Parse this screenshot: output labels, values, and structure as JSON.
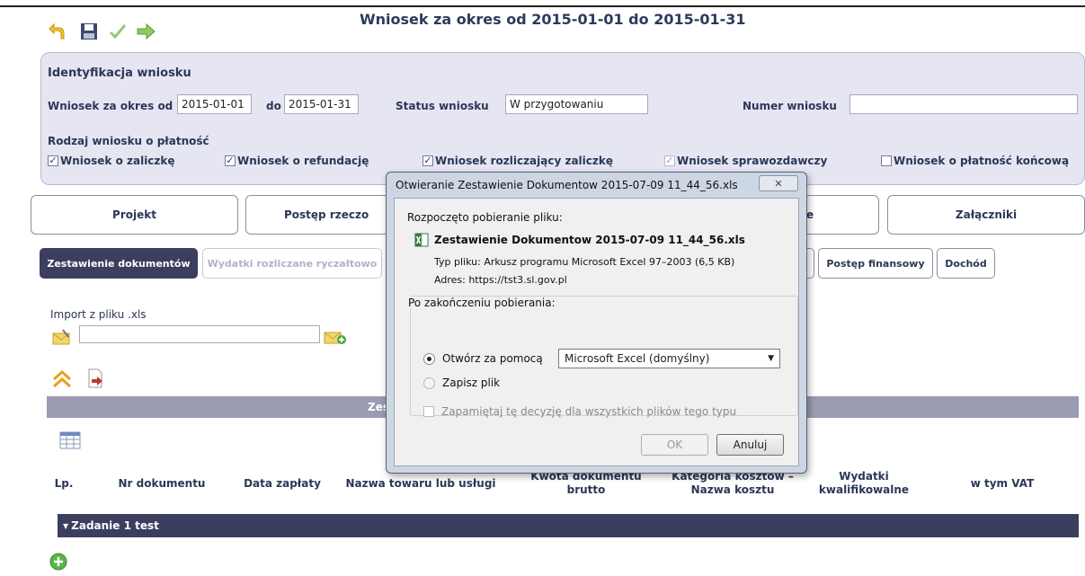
{
  "header": {
    "title": "Wniosek za okres od 2015-01-01 do 2015-01-31",
    "toolbar": [
      "undo-icon",
      "save-icon",
      "check-icon",
      "forward-icon"
    ]
  },
  "identification": {
    "section_title": "Identyfikacja wniosku",
    "period_label": "Wniosek za okres od",
    "period_from": "2015-01-01",
    "period_to_label": "do",
    "period_to": "2015-01-31",
    "status_label": "Status wniosku",
    "status_value": "W przygotowaniu",
    "number_label": "Numer wniosku",
    "number_value": "",
    "kind_label": "Rodzaj wniosku o płatność",
    "kinds": [
      {
        "label": "Wniosek o zaliczkę",
        "checked": true,
        "disabled": false
      },
      {
        "label": "Wniosek o refundację",
        "checked": true,
        "disabled": false
      },
      {
        "label": "Wniosek rozliczający zaliczkę",
        "checked": true,
        "disabled": false
      },
      {
        "label": "Wniosek sprawozdawczy",
        "checked": true,
        "disabled": true
      },
      {
        "label": "Wniosek o płatność końcową",
        "checked": false,
        "disabled": false
      }
    ]
  },
  "main_tabs": [
    "Projekt",
    "Postęp rzeczo",
    "e",
    "Załączniki"
  ],
  "sub_tabs": [
    "Zestawienie dokumentów",
    "Wydatki rozliczane ryczałtowo",
    "Postęp finansowy",
    "Dochód"
  ],
  "import": {
    "label": "Import z pliku .xls",
    "value": ""
  },
  "table": {
    "band_title": "Zes",
    "band_title_right": "",
    "columns": [
      "Lp.",
      "Nr dokumentu",
      "Data zapłaty",
      "Nazwa towaru lub usługi",
      "Kwota dokumentu brutto",
      "Kategoria kosztów – Nazwa kosztu",
      "Wydatki kwalifikowalne",
      "w tym VAT"
    ],
    "group_row": "Zadanie 1 test"
  },
  "dialog": {
    "title": "Otwieranie Zestawienie Dokumentow 2015-07-09 11_44_56.xls",
    "intro": "Rozpoczęto pobieranie pliku:",
    "file_name": "Zestawienie Dokumentow 2015-07-09 11_44_56.xls",
    "type_label": "Typ pliku:",
    "type_value": "Arkusz programu Microsoft Excel 97–2003 (6,5 KB)",
    "address_label": "Adres:",
    "address_value": "https://tst3.sl.gov.pl",
    "after_label": "Po zakończeniu pobierania:",
    "open_with_label": "Otwórz za pomocą",
    "open_with_value": "Microsoft Excel (domyślny)",
    "save_label": "Zapisz plik",
    "remember_label": "Zapamiętaj tę decyzję dla wszystkich plików tego typu",
    "ok_label": "OK",
    "cancel_label": "Anuluj",
    "selected_option": "open"
  },
  "colors": {
    "panel_bg": "#e6e6f3",
    "dark_navy": "#3b3e5f",
    "band_gray": "#9b9bb2",
    "label_text": "#2b3756"
  }
}
